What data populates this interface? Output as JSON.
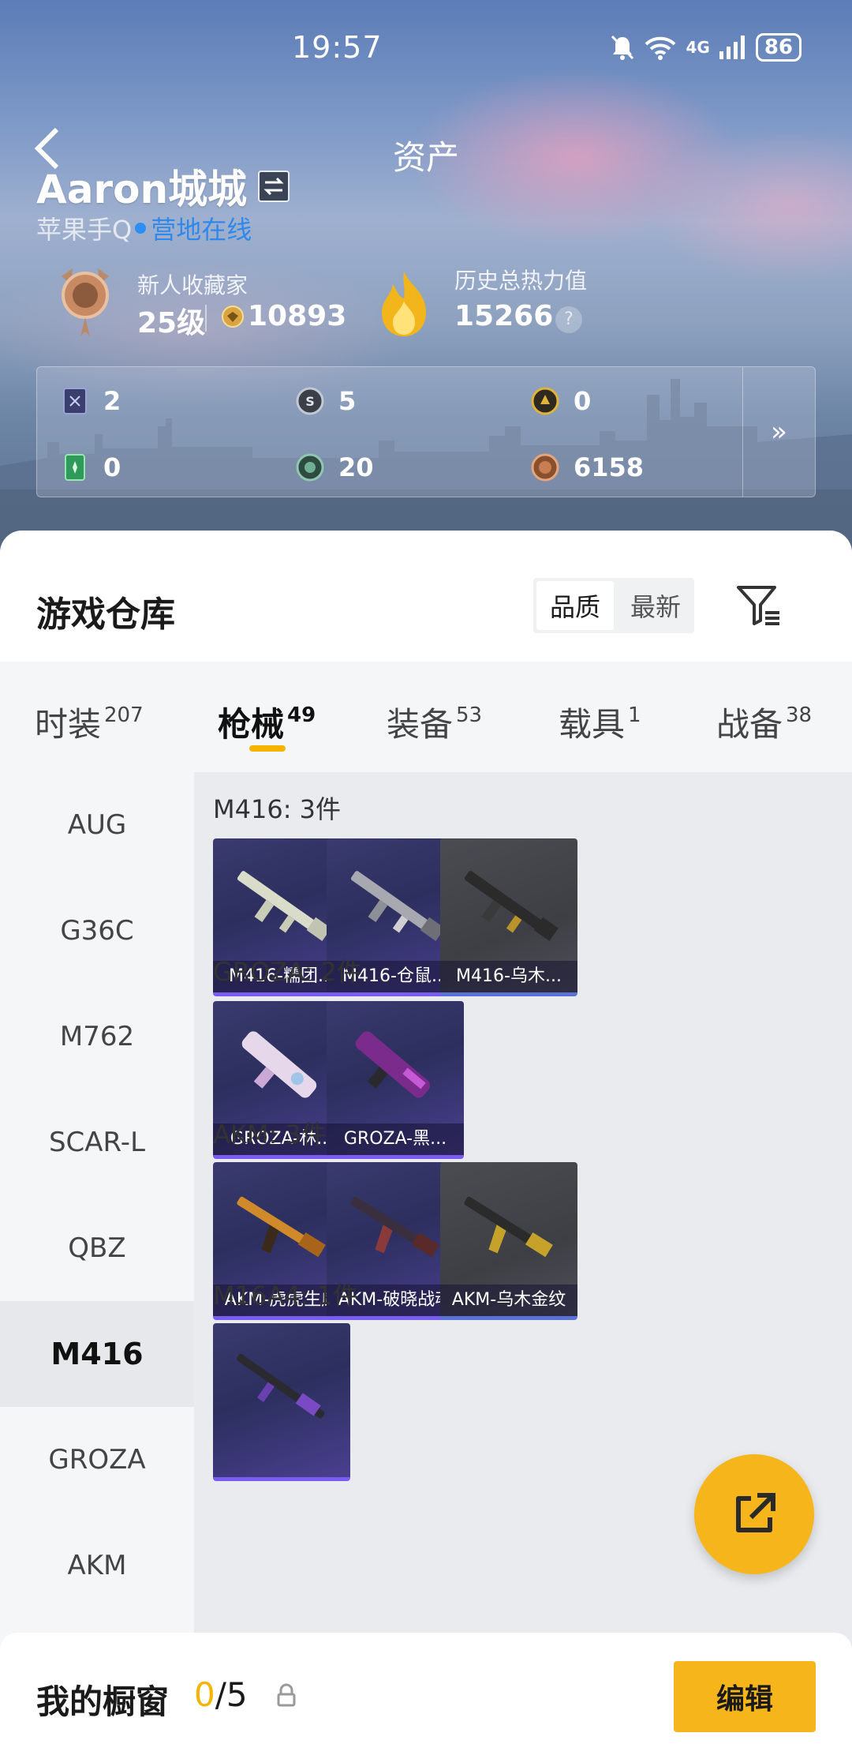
{
  "status_bar": {
    "time": "19:57",
    "network": "4G",
    "battery": "86"
  },
  "header": {
    "title": "资产",
    "username": "Aaron城城",
    "platform": "苹果手Q",
    "online_status": "营地在线",
    "collector_title": "新人收藏家",
    "level": "25级",
    "collection_points": "10893",
    "heat_label": "历史总热力值",
    "heat_value": "15266",
    "help": "?"
  },
  "currencies": [
    {
      "icon": "card-icon",
      "value": "2"
    },
    {
      "icon": "silver-coin-icon",
      "value": "5"
    },
    {
      "icon": "gold-coin-icon",
      "value": "0"
    },
    {
      "icon": "ticket-icon",
      "value": "0"
    },
    {
      "icon": "green-coin-icon",
      "value": "20"
    },
    {
      "icon": "bronze-coin-icon",
      "value": "6158"
    }
  ],
  "currency_more": "»",
  "warehouse": {
    "title": "游戏仓库",
    "sort": {
      "quality": "品质",
      "newest": "最新",
      "selected": "品质"
    }
  },
  "tabs": [
    {
      "label": "时装",
      "count": "207"
    },
    {
      "label": "枪械",
      "count": "49",
      "active": true
    },
    {
      "label": "装备",
      "count": "53"
    },
    {
      "label": "载具",
      "count": "1"
    },
    {
      "label": "战备",
      "count": "38"
    }
  ],
  "weapon_types": [
    "AUG",
    "G36C",
    "M762",
    "SCAR-L",
    "QBZ",
    "M416",
    "GROZA",
    "AKM"
  ],
  "selected_weapon_type": "M416",
  "groups": [
    {
      "title": "M416: 3件",
      "items": [
        {
          "name": "M416-糯团...",
          "style": "purple"
        },
        {
          "name": "M416-仓鼠...",
          "style": "purple"
        },
        {
          "name": "M416-乌木...",
          "style": "gray"
        }
      ]
    },
    {
      "title": "GROZA: 2件",
      "items": [
        {
          "name": "GROZA-林...",
          "style": "purple"
        },
        {
          "name": "GROZA-黑...",
          "style": "purple"
        }
      ]
    },
    {
      "title": "AKM: 3件",
      "items": [
        {
          "name": "AKM-虎虎生威",
          "style": "purple"
        },
        {
          "name": "AKM-破晓战魂",
          "style": "purple"
        },
        {
          "name": "AKM-乌木金纹",
          "style": "gray"
        }
      ]
    },
    {
      "title": "M16A4: 1件",
      "items": [
        {
          "name": "",
          "style": "purple"
        }
      ]
    }
  ],
  "showcase": {
    "label": "我的橱窗",
    "current": "0",
    "total": "/5",
    "edit": "编辑"
  },
  "colors": {
    "accent": "#f6b51a",
    "online": "#2f88ea",
    "rare_border": "#7b5cf0"
  }
}
